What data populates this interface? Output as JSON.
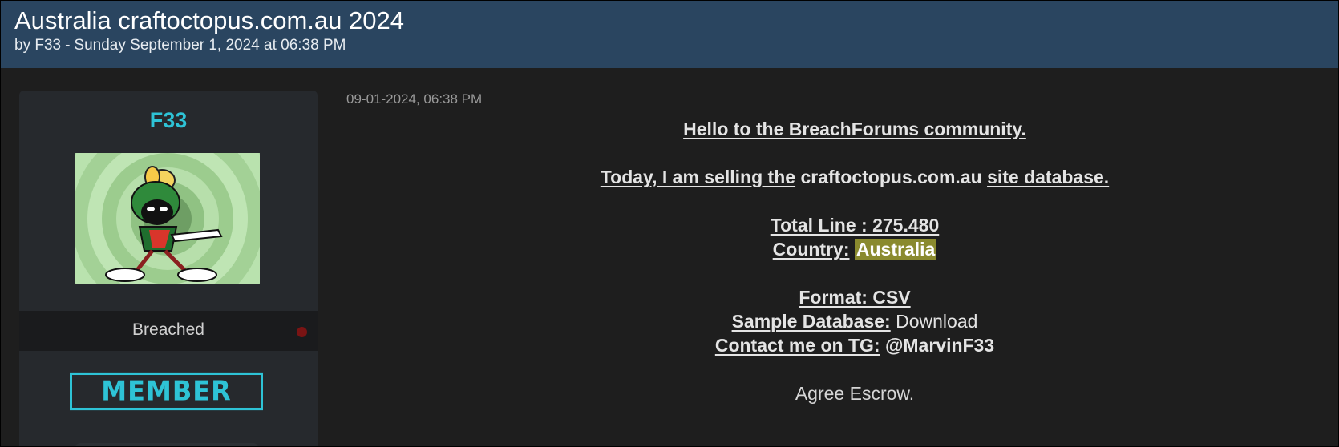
{
  "thread": {
    "title": "Australia craftoctopus.com.au 2024",
    "author_prefix": "by F33",
    "separator": "-",
    "posted_on": "Sunday September 1, 2024 at 06:38 PM"
  },
  "user": {
    "name": "F33",
    "avatar_icon": "martian-cartoon-avatar-icon",
    "status": "Breached",
    "status_color": "#7a1414",
    "rank": "MEMBER",
    "accent_color": "#2ec3d6"
  },
  "post": {
    "date": "09-01-2024, 06:38 PM",
    "greeting": "Hello to the BreachForums community.",
    "selling_prefix": "Today, I am selling the",
    "domain": "craftoctopus.com.au",
    "selling_suffix": "site database.",
    "total_line_label": "Total Line : 275.480",
    "country_label": "Country:",
    "country_value": "Australia",
    "format_label": "Format: CSV",
    "sample_label": "Sample Database:",
    "sample_link": "Download",
    "contact_label": "Contact me on TG:",
    "contact_handle": "@MarvinF33",
    "closing": "Agree Escrow."
  }
}
